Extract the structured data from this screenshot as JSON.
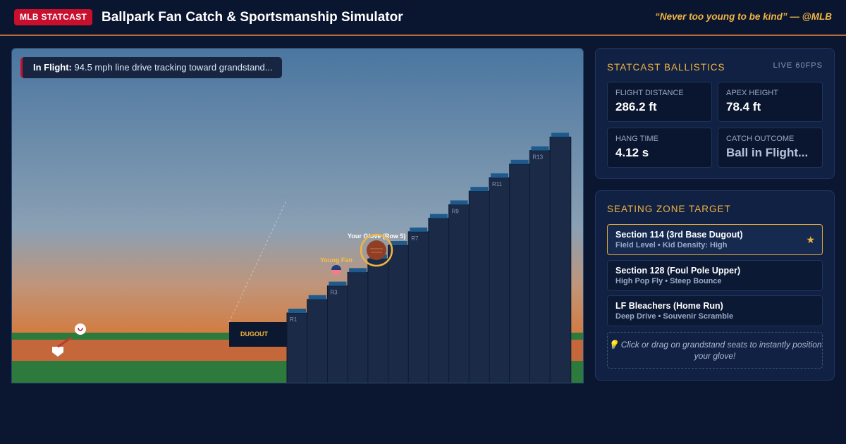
{
  "header": {
    "badge": "MLB STATCAST",
    "title": "Ballpark Fan Catch & Sportsmanship Simulator",
    "tagline": "“Never too young to be kind” — @MLB"
  },
  "stage": {
    "status_label": "In Flight:",
    "status_text": "94.5 mph line drive tracking toward grandstand...",
    "dugout_label": "DUGOUT",
    "glove_label": "Your Glove (Row 5)",
    "fan_label": "Young Fan",
    "row_labels": [
      "R1",
      "R3",
      "R7",
      "R9",
      "R11",
      "R13"
    ]
  },
  "ballistics": {
    "title": "STATCAST BALLISTICS",
    "live": "LIVE 60FPS",
    "stats": [
      {
        "label": "FLIGHT DISTANCE",
        "value": "286.2 ft"
      },
      {
        "label": "APEX HEIGHT",
        "value": "78.4 ft"
      },
      {
        "label": "HANG TIME",
        "value": "4.12 s"
      },
      {
        "label": "CATCH OUTCOME",
        "value": "Ball in Flight..."
      }
    ]
  },
  "zones": {
    "title": "SEATING ZONE TARGET",
    "items": [
      {
        "name": "Section 114 (3rd Base Dugout)",
        "sub": "Field Level • Kid Density: High",
        "selected": true
      },
      {
        "name": "Section 128 (Foul Pole Upper)",
        "sub": "High Pop Fly • Steep Bounce",
        "selected": false
      },
      {
        "name": "LF Bleachers (Home Run)",
        "sub": "Deep Drive • Souvenir Scramble",
        "selected": false
      }
    ],
    "hint": "💡 Click or drag on grandstand seats to instantly position your glove!"
  },
  "colors": {
    "accent": "#f2b441",
    "brand_red": "#c8102e",
    "background": "#0b1730"
  }
}
